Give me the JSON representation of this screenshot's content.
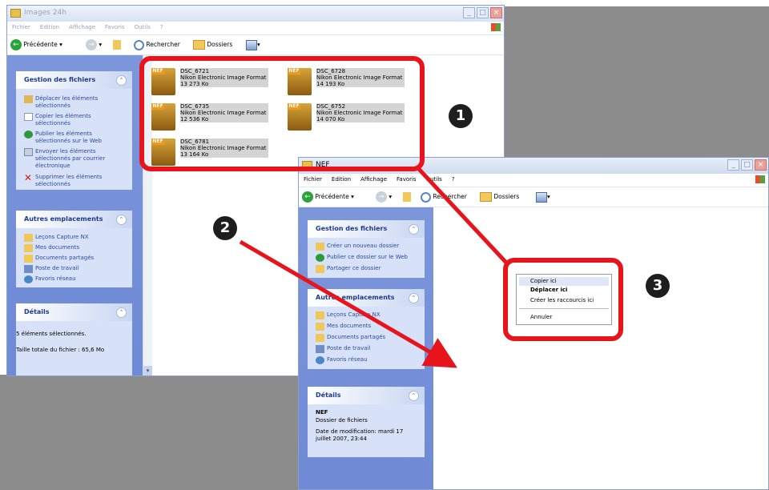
{
  "window1": {
    "title": "Images 24h",
    "menu": [
      "Fichier",
      "Edition",
      "Affichage",
      "Favoris",
      "Outils",
      "?"
    ],
    "toolbar": {
      "back_label": "Précédente",
      "search_label": "Rechercher",
      "folders_label": "Dossiers"
    },
    "file_tasks": {
      "title": "Gestion des fichiers",
      "items": [
        "Déplacer les éléments sélectionnés",
        "Copier les éléments sélectionnés",
        "Publier les éléments sélectionnés sur le Web",
        "Envoyer les éléments sélectionnés par courrier électronique",
        "Supprimer les éléments sélectionnés"
      ]
    },
    "other_places": {
      "title": "Autres emplacements",
      "items": [
        "Leçons Capture NX",
        "Mes documents",
        "Documents partagés",
        "Poste de travail",
        "Favoris réseau"
      ]
    },
    "details": {
      "title": "Détails",
      "selected": "5 éléments sélectionnés.",
      "total_size": "Taille totale du fichier : 65,6 Mo"
    },
    "files": [
      {
        "name": "DSC_6721",
        "type": "Nikon Electronic Image Format",
        "size": "13 273 Ko"
      },
      {
        "name": "DSC_6728",
        "type": "Nikon Electronic Image Format",
        "size": "14 193 Ko"
      },
      {
        "name": "DSC_6735",
        "type": "Nikon Electronic Image Format",
        "size": "12 536 Ko"
      },
      {
        "name": "DSC_6752",
        "type": "Nikon Electronic Image Format",
        "size": "14 070 Ko"
      },
      {
        "name": "DSC_6781",
        "type": "Nikon Electronic Image Format",
        "size": "13 164 Ko"
      }
    ],
    "file_tag": "NEF"
  },
  "window2": {
    "title": "NEF",
    "menu": [
      "Fichier",
      "Edition",
      "Affichage",
      "Favoris",
      "Outils",
      "?"
    ],
    "toolbar": {
      "back_label": "Précédente",
      "search_label": "Rechercher",
      "folders_label": "Dossiers"
    },
    "file_tasks": {
      "title": "Gestion des fichiers",
      "items": [
        "Créer un nouveau dossier",
        "Publier ce dossier sur le Web",
        "Partager ce dossier"
      ]
    },
    "other_places": {
      "title": "Autres emplacements",
      "items": [
        "Leçons Capture NX",
        "Mes documents",
        "Documents partagés",
        "Poste de travail",
        "Favoris réseau"
      ]
    },
    "details": {
      "title": "Détails",
      "name": "NEF",
      "kind": "Dossier de fichiers",
      "modified": "Date de modification: mardi 17 juillet 2007, 23:44"
    }
  },
  "context_menu": {
    "items": [
      "Copier ici",
      "Déplacer ici",
      "Créer les raccourcis ici"
    ],
    "cancel": "Annuler"
  },
  "badges": [
    "1",
    "2",
    "3"
  ],
  "colors": {
    "highlight": "#e8141c",
    "badge": "#1e1e1e",
    "pane": "#7c96dc",
    "box": "#d7e2f8"
  }
}
